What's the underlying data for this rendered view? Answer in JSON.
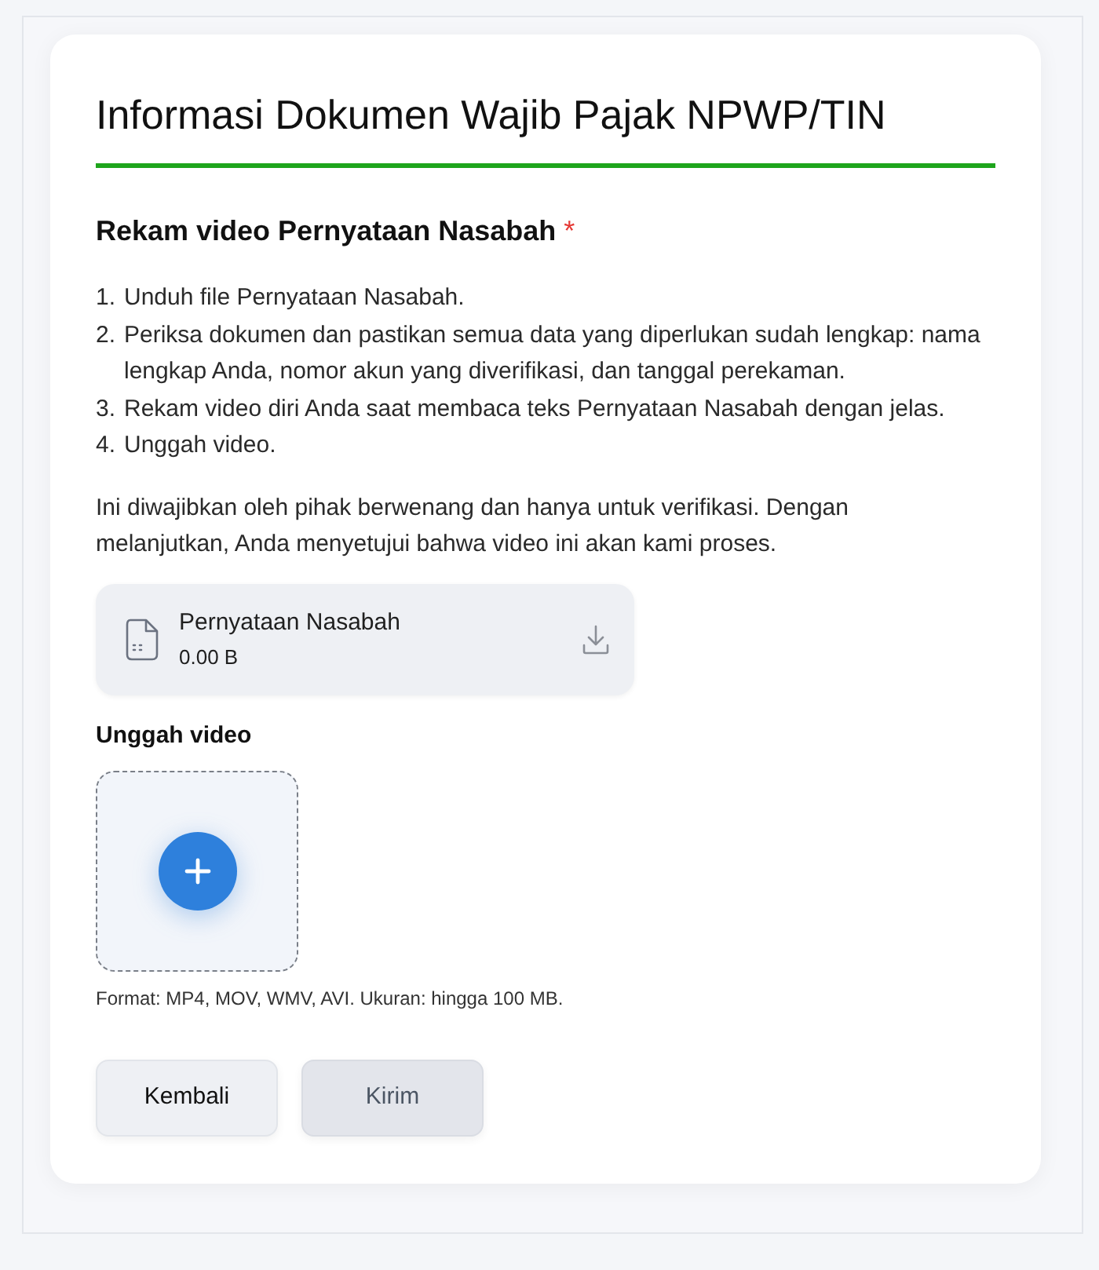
{
  "page": {
    "title": "Informasi Dokumen Wajib Pajak NPWP/TIN"
  },
  "section": {
    "heading": "Rekam video Pernyataan Nasabah",
    "required_mark": "*",
    "steps": [
      {
        "number": "1.",
        "text": "Unduh file Pernyataan Nasabah."
      },
      {
        "number": "2.",
        "text": "Periksa dokumen dan pastikan semua data yang diperlukan sudah lengkap: nama lengkap Anda, nomor akun yang diverifikasi, dan tanggal perekaman."
      },
      {
        "number": "3.",
        "text": "Rekam video diri Anda saat membaca teks Pernyataan Nasabah dengan jelas."
      },
      {
        "number": "4.",
        "text": "Unggah video."
      }
    ],
    "notice": "Ini diwajibkan oleh pihak berwenang dan hanya untuk verifikasi. Dengan melanjutkan, Anda menyetujui bahwa video ini akan kami proses."
  },
  "file": {
    "name": "Pernyataan Nasabah",
    "size": "0.00 B"
  },
  "upload": {
    "label": "Unggah video",
    "hint": "Format: MP4, MOV, WMV, AVI. Ukuran: hingga 100 MB."
  },
  "buttons": [
    {
      "label": "Kembali",
      "disabled": false
    },
    {
      "label": "Kirim",
      "disabled": true
    }
  ]
}
